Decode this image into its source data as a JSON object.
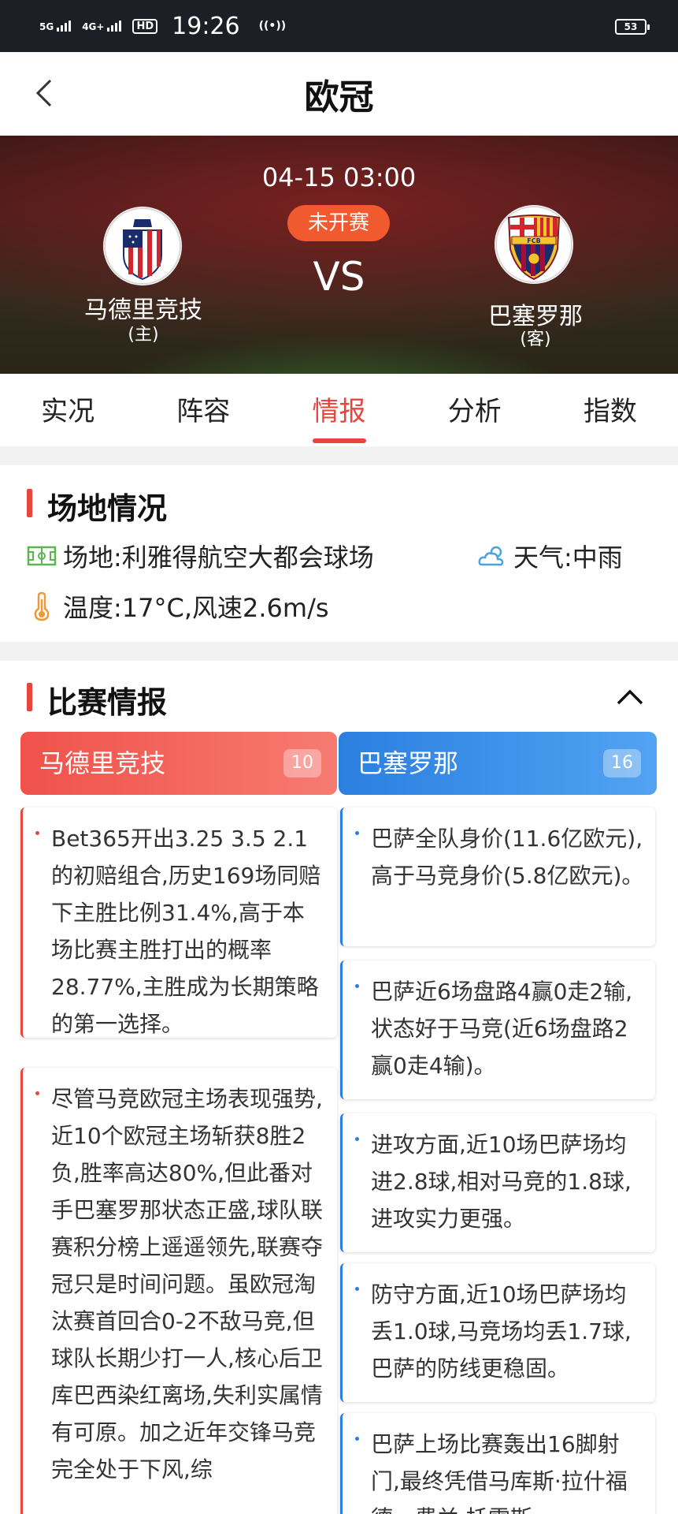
{
  "status_bar": {
    "net1": "5G",
    "net2": "4G+",
    "hd": "HD",
    "time": "19:26",
    "battery": "53"
  },
  "nav": {
    "title": "欧冠"
  },
  "match": {
    "datetime": "04-15 03:00",
    "status": "未开赛",
    "vs": "VS",
    "home": {
      "name": "马德里竞技",
      "role": "(主)"
    },
    "away": {
      "name": "巴塞罗那",
      "role": "(客)"
    }
  },
  "tabs": [
    {
      "label": "实况"
    },
    {
      "label": "阵容"
    },
    {
      "label": "情报"
    },
    {
      "label": "分析"
    },
    {
      "label": "指数"
    }
  ],
  "venue": {
    "title": "场地情况",
    "venue": "场地:利雅得航空大都会球场",
    "weather": "天气:中雨",
    "temperature": "温度:17°C,风速2.6m/s"
  },
  "intel": {
    "title": "比赛情报",
    "home": {
      "name": "马德里竞技",
      "count": "10",
      "notes": [
        "Bet365开出3.25 3.5 2.1的初赔组合,历史169场同赔下主胜比例31.4%,高于本场比赛主胜打出的概率28.77%,主胜成为长期策略的第一选择。",
        "尽管马竞欧冠主场表现强势,近10个欧冠主场斩获8胜2负,胜率高达80%,但此番对手巴塞罗那状态正盛,球队联赛积分榜上遥遥领先,联赛夺冠只是时间问题。虽欧冠淘汰赛首回合0-2不敌马竞,但球队长期少打一人,核心后卫库巴西染红离场,失利实属情有可原。加之近年交锋马竞完全处于下风,综"
      ]
    },
    "away": {
      "name": "巴塞罗那",
      "count": "16",
      "notes": [
        "巴萨全队身价(11.6亿欧元),高于马竞身价(5.8亿欧元)。",
        "巴萨近6场盘路4赢0走2输,状态好于马竞(近6场盘路2赢0走4输)。",
        "进攻方面,近10场巴萨场均进2.8球,相对马竞的1.8球,进攻实力更强。",
        "防守方面,近10场巴萨场均丢1.0球,马竞场均丢1.7球,巴萨的防线更稳固。",
        "巴萨上场比赛轰出16脚射门,最终凭借马库斯·拉什福德、费兰·托雷斯"
      ]
    }
  }
}
